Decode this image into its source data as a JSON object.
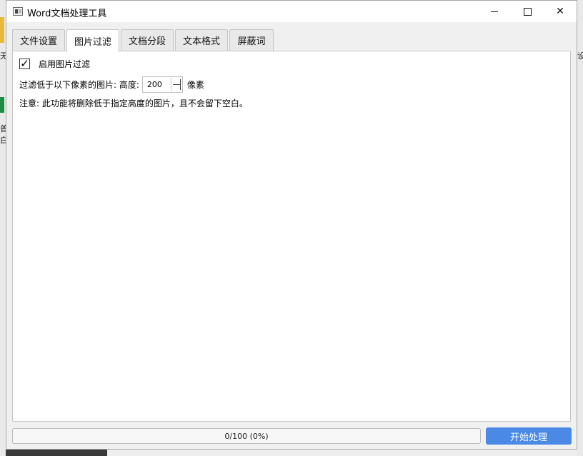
{
  "window": {
    "title": "Word文档处理工具"
  },
  "tabs": [
    {
      "label": "文件设置",
      "active": false
    },
    {
      "label": "图片过滤",
      "active": true
    },
    {
      "label": "文档分段",
      "active": false
    },
    {
      "label": "文本格式",
      "active": false
    },
    {
      "label": "屏蔽词",
      "active": false
    }
  ],
  "image_filter": {
    "enable_label": "启用图片过滤",
    "enabled": true,
    "filter_label": "过滤低于以下像素的图片: 高度:",
    "height_value": "200",
    "unit_label": "像素",
    "note": "注意: 此功能将删除低于指定高度的图片，且不会留下空白。"
  },
  "footer": {
    "progress_text": "0/100 (0%)",
    "progress_fraction": 0,
    "start_button": "开始处理"
  },
  "desktop": {
    "left_fragments": [
      "无",
      "普",
      "白"
    ],
    "right_fragment": "设"
  },
  "colors": {
    "accent": "#4a8ae6",
    "window_bg": "#f0f0f0",
    "panel_bg": "#ffffff"
  }
}
